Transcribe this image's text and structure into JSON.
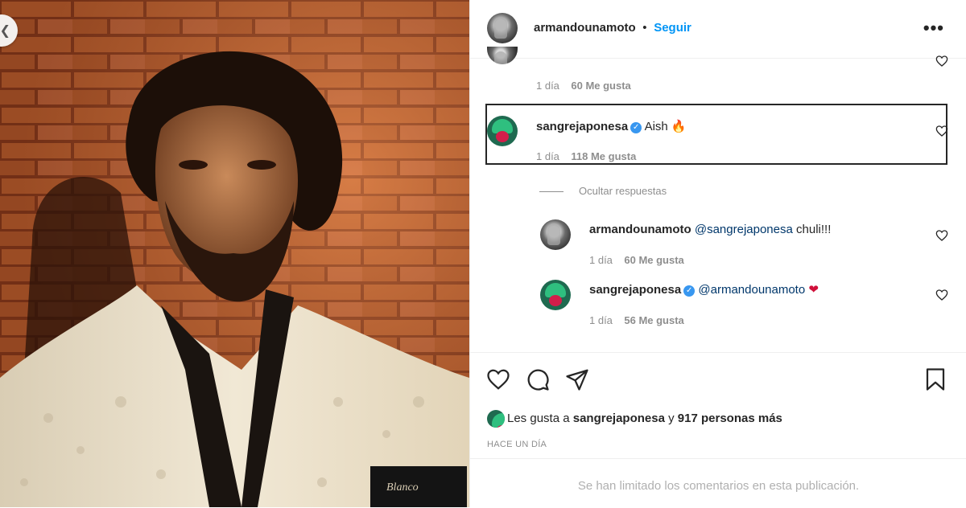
{
  "post": {
    "author": "armandounamoto",
    "follow_label": "Seguir",
    "more_label": "•••"
  },
  "comments": {
    "partial": {
      "time": "1 día",
      "likes": "60 Me gusta"
    },
    "highlighted": {
      "user": "sangrejaponesa",
      "text": "Aish",
      "emoji": "🔥",
      "time": "1 día",
      "likes": "118 Me gusta"
    },
    "hide_replies_label": "Ocultar respuestas",
    "replies": [
      {
        "user": "armandounamoto",
        "mention": "@sangrejaponesa",
        "text": " chuli!!!",
        "time": "1 día",
        "likes": "60 Me gusta"
      },
      {
        "user": "sangrejaponesa",
        "mention": "@armandounamoto",
        "emoji": "❤",
        "time": "1 día",
        "likes": "56 Me gusta"
      }
    ]
  },
  "likes_line": {
    "prefix": "Les gusta a ",
    "user": "sangrejaponesa",
    "middle": " y ",
    "count": "917 personas más"
  },
  "time_ago": "HACE UN DÍA",
  "comments_limited": "Se han limitado los comentarios en esta publicación.",
  "icons": [
    "heart-icon",
    "comment-icon",
    "share-icon",
    "bookmark-icon",
    "verified-icon",
    "back-icon"
  ],
  "colors": {
    "link": "#0095f6",
    "mention": "#00376b",
    "verified": "#3897f0",
    "brick": "#b4532a"
  }
}
